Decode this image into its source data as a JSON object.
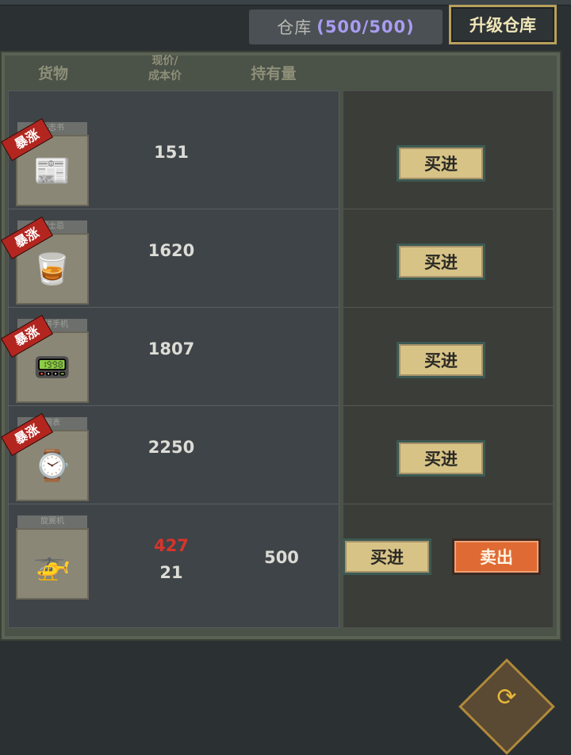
{
  "warehouse": {
    "label": "仓库",
    "count": "(500/500)"
  },
  "upgrade_label": "升级仓库",
  "headers": {
    "goods": "货物",
    "price_line1": "现价/",
    "price_line2": "成本价",
    "holding": "持有量"
  },
  "surge_label": "暴涨",
  "items": [
    {
      "tab": "杂志书",
      "icon": "magazine-icon",
      "price": "151",
      "buy": "买进"
    },
    {
      "tab": "威士忌",
      "icon": "whiskey-icon",
      "price": "1620",
      "buy": "买进"
    },
    {
      "tab": "对讲手机",
      "icon": "walkie-talkie-icon",
      "price": "1807",
      "buy": "买进"
    },
    {
      "tab": "腕表",
      "icon": "wristwatch-icon",
      "price": "2250",
      "buy": "买进"
    },
    {
      "tab": "旋翼机",
      "icon": "gyrocopter-icon",
      "price": "427",
      "cost": "21",
      "holding": "500",
      "buy": "买进",
      "sell": "卖出"
    }
  ],
  "colors": {
    "accent_purple": "#a99cf2",
    "price_red": "#d8342c",
    "sell_orange": "#e06a33",
    "badge_red": "#b3261f"
  }
}
